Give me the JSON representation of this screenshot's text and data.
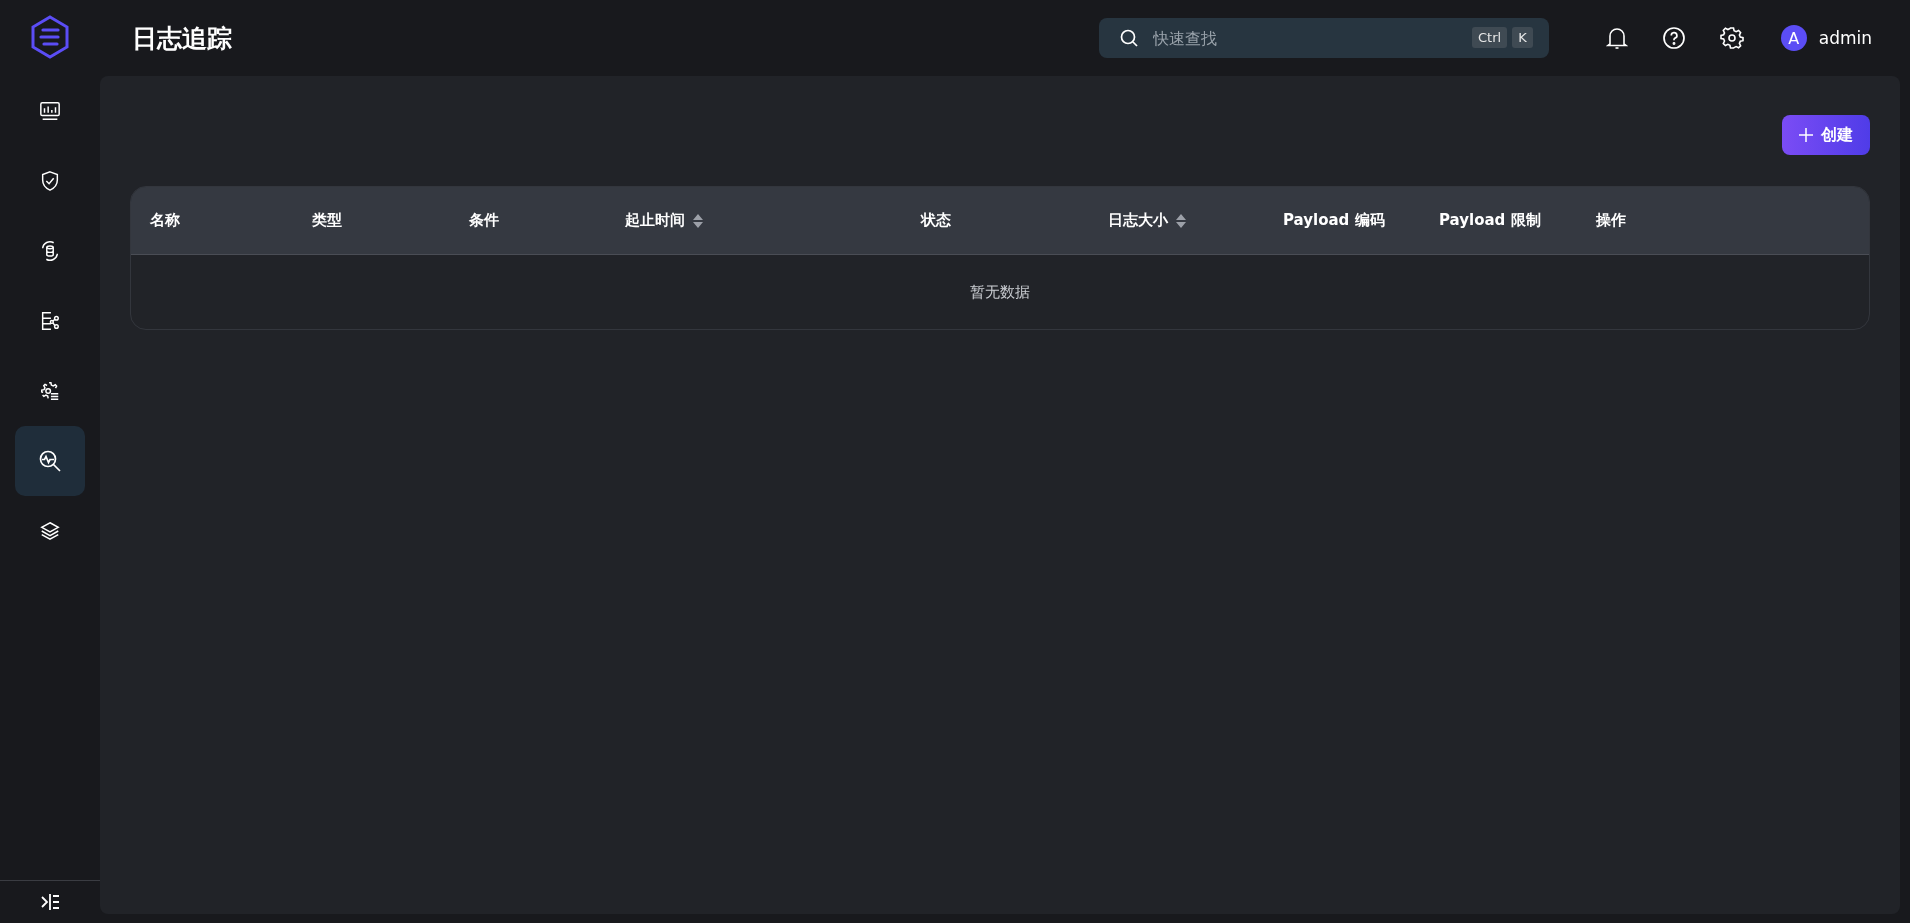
{
  "page_title": "日志追踪",
  "search": {
    "placeholder": "快速查找",
    "shortcut_keys": [
      "Ctrl",
      "K"
    ]
  },
  "user": {
    "avatar_letter": "A",
    "name": "admin"
  },
  "sidebar": {
    "items": [
      {
        "selected": false
      },
      {
        "selected": false
      },
      {
        "selected": false
      },
      {
        "selected": false
      },
      {
        "selected": false
      },
      {
        "selected": true
      },
      {
        "selected": false
      }
    ]
  },
  "create_button": "创建",
  "table": {
    "columns": [
      {
        "label": "名称",
        "sortable": false
      },
      {
        "label": "类型",
        "sortable": false
      },
      {
        "label": "条件",
        "sortable": false
      },
      {
        "label": "起止时间",
        "sortable": true
      },
      {
        "label": "状态",
        "sortable": false
      },
      {
        "label": "日志大小",
        "sortable": true
      },
      {
        "label": "Payload 编码",
        "sortable": false
      },
      {
        "label": "Payload 限制",
        "sortable": false
      },
      {
        "label": "操作",
        "sortable": false
      }
    ],
    "empty_text": "暂无数据"
  }
}
